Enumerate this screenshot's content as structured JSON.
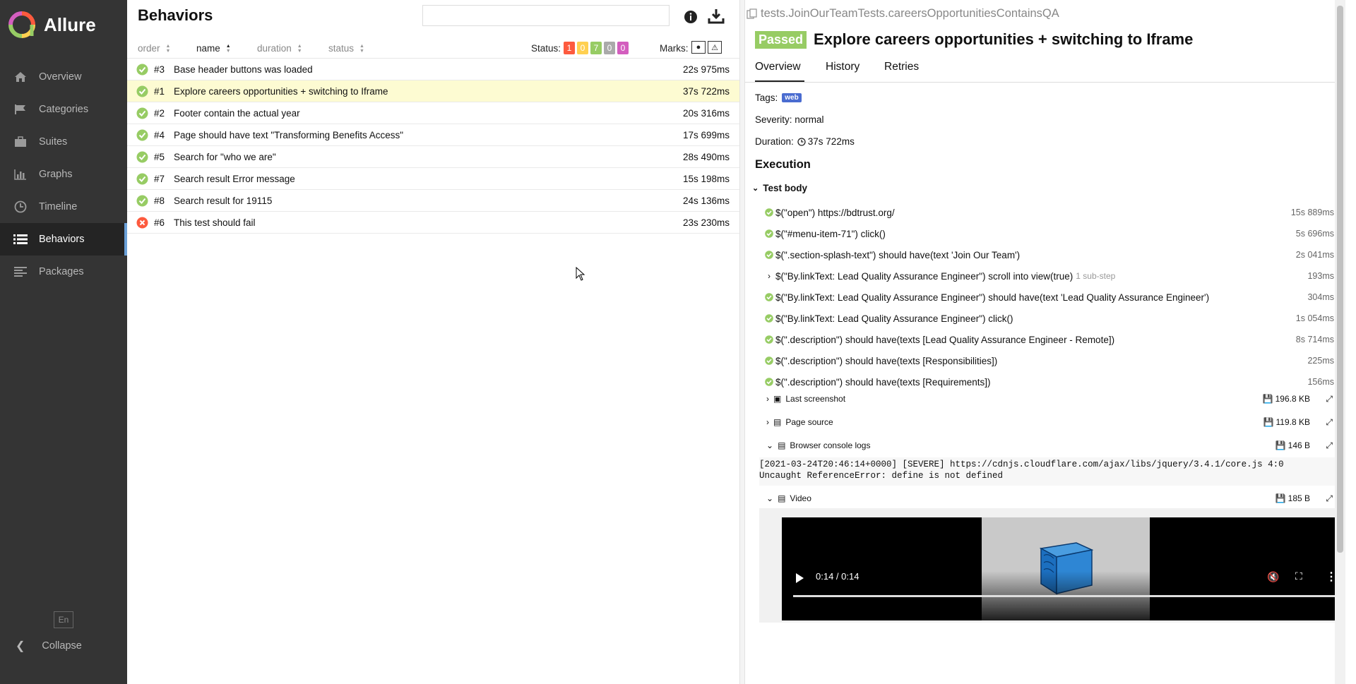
{
  "sidebar": {
    "brand": "Allure",
    "items": [
      {
        "label": "Overview",
        "icon": "home-icon"
      },
      {
        "label": "Categories",
        "icon": "flag-icon"
      },
      {
        "label": "Suites",
        "icon": "briefcase-icon"
      },
      {
        "label": "Graphs",
        "icon": "bar-chart-icon"
      },
      {
        "label": "Timeline",
        "icon": "clock-icon"
      },
      {
        "label": "Behaviors",
        "icon": "list-icon"
      },
      {
        "label": "Packages",
        "icon": "align-left-icon"
      }
    ],
    "active": "Behaviors",
    "lang": "En",
    "collapse": "Collapse"
  },
  "behaviors": {
    "title": "Behaviors",
    "search": {
      "value": "",
      "placeholder": ""
    },
    "columns": {
      "order": "order",
      "name": "name",
      "duration": "duration",
      "status": "status"
    },
    "status_label": "Status:",
    "status_counts": [
      {
        "value": "1",
        "color": "#fd5a3e"
      },
      {
        "value": "0",
        "color": "#ffd050"
      },
      {
        "value": "7",
        "color": "#97cc64"
      },
      {
        "value": "0",
        "color": "#aaaaaa"
      },
      {
        "value": "0",
        "color": "#d35ebe"
      }
    ],
    "marks_label": "Marks:",
    "rows": [
      {
        "num": "#3",
        "name": "Base header buttons was loaded",
        "duration": "22s 975ms",
        "status": "passed"
      },
      {
        "num": "#1",
        "name": "Explore careers opportunities + switching to Iframe",
        "duration": "37s 722ms",
        "status": "passed",
        "selected": true
      },
      {
        "num": "#2",
        "name": "Footer contain the actual year",
        "duration": "20s 316ms",
        "status": "passed"
      },
      {
        "num": "#4",
        "name": "Page should have text \"Transforming Benefits Access\"",
        "duration": "17s 699ms",
        "status": "passed"
      },
      {
        "num": "#5",
        "name": "Search for \"who we are\"",
        "duration": "28s 490ms",
        "status": "passed"
      },
      {
        "num": "#7",
        "name": "Search result Error message",
        "duration": "15s 198ms",
        "status": "passed"
      },
      {
        "num": "#8",
        "name": "Search result for 19115",
        "duration": "24s 136ms",
        "status": "passed"
      },
      {
        "num": "#6",
        "name": "This test should fail",
        "duration": "23s 230ms",
        "status": "failed"
      }
    ]
  },
  "detail": {
    "full_name": "tests.JoinOurTeamTests.careersOpportunitiesContainsQA",
    "status": "Passed",
    "title": "Explore careers opportunities + switching to Iframe",
    "tabs": [
      "Overview",
      "History",
      "Retries"
    ],
    "tags_label": "Tags:",
    "tag": "web",
    "severity": "Severity: normal",
    "duration_label": "Duration:",
    "duration": "37s 722ms",
    "execution": "Execution",
    "test_body": "Test body",
    "steps": [
      {
        "text": "$(\"open\") https://bdtrust.org/",
        "duration": "15s 889ms"
      },
      {
        "text": "$(\"#menu-item-71\") click()",
        "duration": "5s 696ms"
      },
      {
        "text": "$(\".section-splash-text\") should have(text 'Join Our Team')",
        "duration": "2s 041ms"
      },
      {
        "text": "$(\"By.linkText: Lead Quality Assurance Engineer\") scroll into view(true)",
        "extra": "1 sub-step",
        "duration": "193ms",
        "expandable": true
      },
      {
        "text": "$(\"By.linkText: Lead Quality Assurance Engineer\") should have(text 'Lead Quality Assurance Engineer')",
        "duration": "304ms"
      },
      {
        "text": "$(\"By.linkText: Lead Quality Assurance Engineer\") click()",
        "duration": "1s 054ms"
      },
      {
        "text": "$(\".description\") should have(texts [Lead Quality Assurance Engineer - Remote])",
        "duration": "8s 714ms"
      },
      {
        "text": "$(\".description\") should have(texts [Responsibilities])",
        "duration": "225ms"
      },
      {
        "text": "$(\".description\") should have(texts [Requirements])",
        "duration": "156ms"
      }
    ],
    "attachments": [
      {
        "name": "Last screenshot",
        "size": "196.8 KB"
      },
      {
        "name": "Page source",
        "size": "119.8 KB"
      },
      {
        "name": "Browser console logs",
        "size": "146 B"
      },
      {
        "name": "Video",
        "size": "185 B"
      }
    ],
    "console_lines": [
      "[2021-03-24T20:46:14+0000] [SEVERE] https://cdnjs.cloudflare.com/ajax/libs/jquery/3.4.1/core.js 4:0",
      "Uncaught ReferenceError: define is not defined"
    ],
    "video_time": "0:14 / 0:14"
  }
}
